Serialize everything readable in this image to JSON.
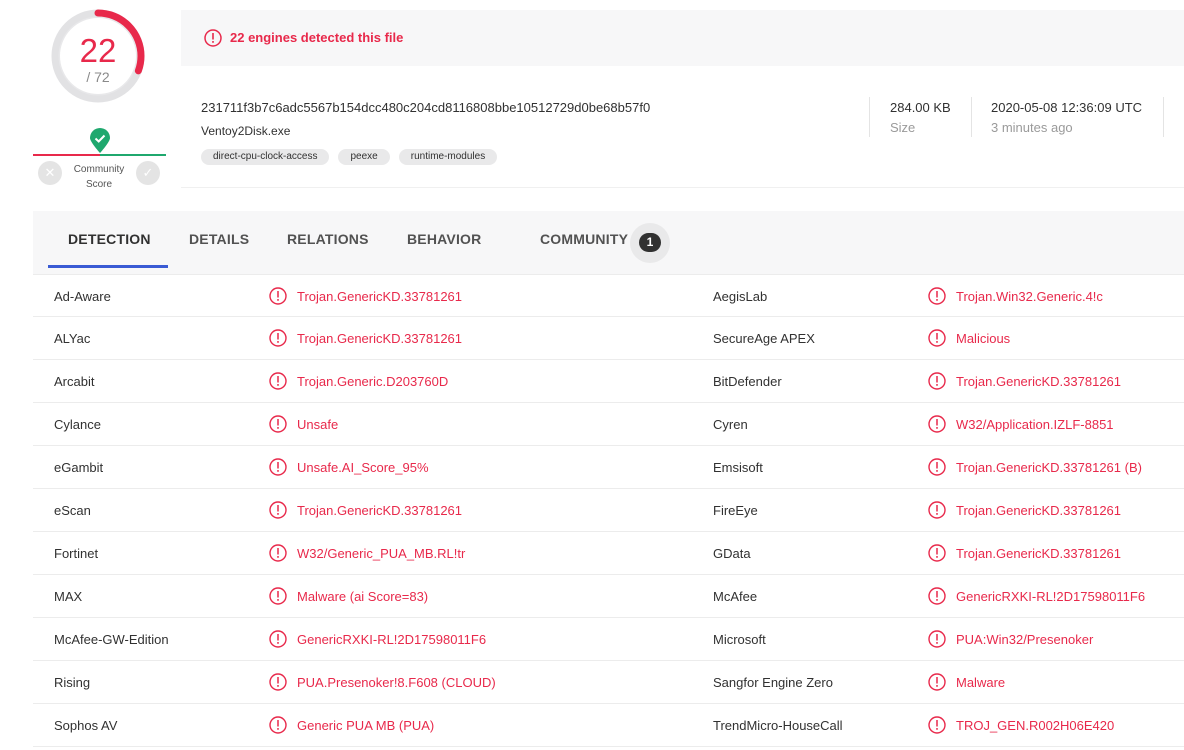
{
  "score": {
    "detected": "22",
    "total": "/ 72",
    "fraction": 0.3056
  },
  "community": {
    "label_line1": "Community",
    "label_line2": "Score"
  },
  "alert": {
    "text": "22 engines detected this file"
  },
  "file": {
    "hash": "231711f3b7c6adc5567b154dcc480c204cd8116808bbe10512729d0be68b57f0",
    "name": "Ventoy2Disk.exe",
    "tags": [
      "direct-cpu-clock-access",
      "peexe",
      "runtime-modules"
    ],
    "size": "284.00 KB",
    "size_label": "Size",
    "date": "2020-05-08 12:36:09 UTC",
    "date_ago": "3 minutes ago"
  },
  "tabs": [
    {
      "label": "DETECTION"
    },
    {
      "label": "DETAILS"
    },
    {
      "label": "RELATIONS"
    },
    {
      "label": "BEHAVIOR"
    },
    {
      "label": "COMMUNITY"
    }
  ],
  "community_count": "1",
  "colors": {
    "malicious": "#e8294b",
    "accent": "#3a5bd4",
    "clean": "#1fa86e"
  },
  "detections": [
    {
      "left_engine": "Ad-Aware",
      "left_result": "Trojan.GenericKD.33781261",
      "right_engine": "AegisLab",
      "right_result": "Trojan.Win32.Generic.4!c"
    },
    {
      "left_engine": "ALYac",
      "left_result": "Trojan.GenericKD.33781261",
      "right_engine": "SecureAge APEX",
      "right_result": "Malicious"
    },
    {
      "left_engine": "Arcabit",
      "left_result": "Trojan.Generic.D203760D",
      "right_engine": "BitDefender",
      "right_result": "Trojan.GenericKD.33781261"
    },
    {
      "left_engine": "Cylance",
      "left_result": "Unsafe",
      "right_engine": "Cyren",
      "right_result": "W32/Application.IZLF-8851"
    },
    {
      "left_engine": "eGambit",
      "left_result": "Unsafe.AI_Score_95%",
      "right_engine": "Emsisoft",
      "right_result": "Trojan.GenericKD.33781261 (B)"
    },
    {
      "left_engine": "eScan",
      "left_result": "Trojan.GenericKD.33781261",
      "right_engine": "FireEye",
      "right_result": "Trojan.GenericKD.33781261"
    },
    {
      "left_engine": "Fortinet",
      "left_result": "W32/Generic_PUA_MB.RL!tr",
      "right_engine": "GData",
      "right_result": "Trojan.GenericKD.33781261"
    },
    {
      "left_engine": "MAX",
      "left_result": "Malware (ai Score=83)",
      "right_engine": "McAfee",
      "right_result": "GenericRXKI-RL!2D17598011F6"
    },
    {
      "left_engine": "McAfee-GW-Edition",
      "left_result": "GenericRXKI-RL!2D17598011F6",
      "right_engine": "Microsoft",
      "right_result": "PUA:Win32/Presenoker"
    },
    {
      "left_engine": "Rising",
      "left_result": "PUA.Presenoker!8.F608 (CLOUD)",
      "right_engine": "Sangfor Engine Zero",
      "right_result": "Malware"
    },
    {
      "left_engine": "Sophos AV",
      "left_result": "Generic PUA MB (PUA)",
      "right_engine": "TrendMicro-HouseCall",
      "right_result": "TROJ_GEN.R002H06E420"
    }
  ]
}
